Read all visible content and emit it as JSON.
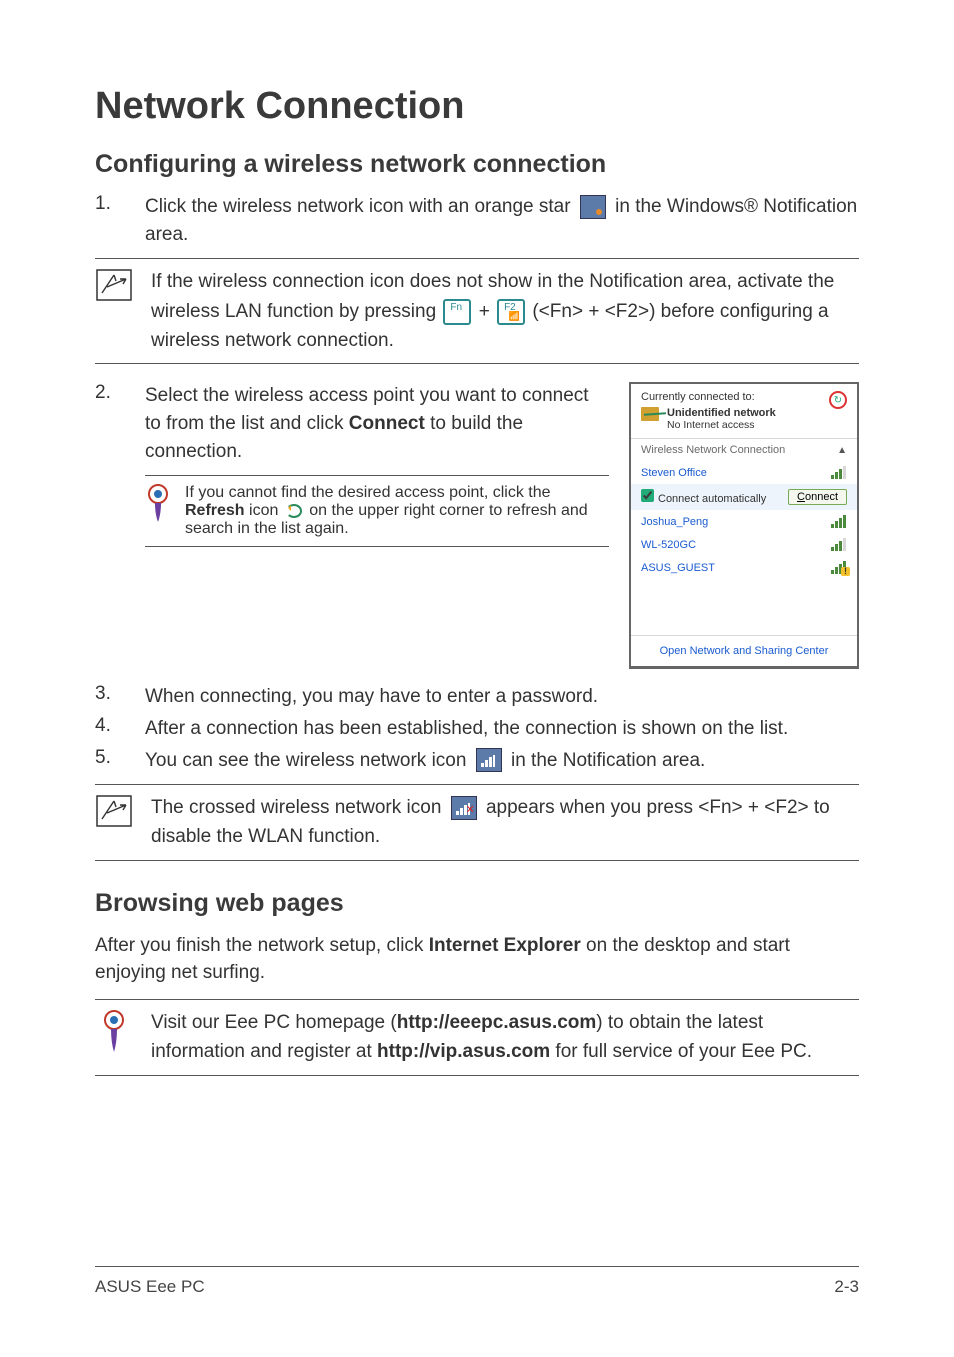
{
  "title": "Network Connection",
  "section1_heading": "Configuring a wireless network connection",
  "step1": {
    "num": "1.",
    "pre": "Click the wireless network icon with an orange star ",
    "post": " in the Windows® Notification area."
  },
  "note1": {
    "line1": "If the wireless connection icon does not show in the Notification area, activate the wireless LAN function by pressing ",
    "plus": " + ",
    "line2": " (<Fn> + <F2>) before configuring a wireless network connection.",
    "key1_top": "Fn",
    "key2_top": "F2"
  },
  "step2": {
    "num": "2.",
    "pre": "Select the wireless access point you want to connect to from the list and click ",
    "bold": "Connect",
    "post": " to build the connection."
  },
  "inner_tip": {
    "pre": "If you cannot find the desired access point, click the ",
    "bold": "Refresh",
    "mid": " icon ",
    "post": " on the upper right corner to refresh and search in the list again."
  },
  "popup": {
    "currently": "Currently connected to:",
    "unid_title": "Unidentified network",
    "unid_sub": "No Internet access",
    "wnc": "Wireless Network Connection",
    "networks": [
      {
        "name": "Steven Office",
        "cls": "p3"
      },
      {
        "name": "Joshua_Peng",
        "cls": ""
      },
      {
        "name": "WL-520GC",
        "cls": "p3"
      },
      {
        "name": "ASUS_GUEST",
        "cls": "warn"
      }
    ],
    "auto_label": "Connect automatically",
    "connect_label": "Connect",
    "footer": "Open Network and Sharing Center",
    "arrow_up": "▲"
  },
  "step3": {
    "num": "3.",
    "text": "When connecting, you may have to enter a password."
  },
  "step4": {
    "num": "4.",
    "text": "After a connection has been established, the connection is shown on the list."
  },
  "step5": {
    "num": "5.",
    "pre": "You can see the wireless network icon ",
    "post": " in the Notification area."
  },
  "note2": {
    "pre": "The crossed wireless network icon ",
    "post": " appears when you press <Fn> + <F2> to disable the WLAN function."
  },
  "section2_heading": "Browsing web pages",
  "browsing_para": {
    "pre": "After you finish the network setup, click ",
    "bold": "Internet Explorer",
    "post": " on the desktop and start enjoying net surfing."
  },
  "note3": {
    "pre": "Visit our Eee PC homepage (",
    "b1": "http://eeepc.asus.com",
    "mid": ") to obtain the latest information and register at ",
    "b2": "http://vip.asus.com",
    "post": " for full service of your Eee PC."
  },
  "footer": {
    "left": "ASUS Eee PC",
    "right": "2-3"
  }
}
